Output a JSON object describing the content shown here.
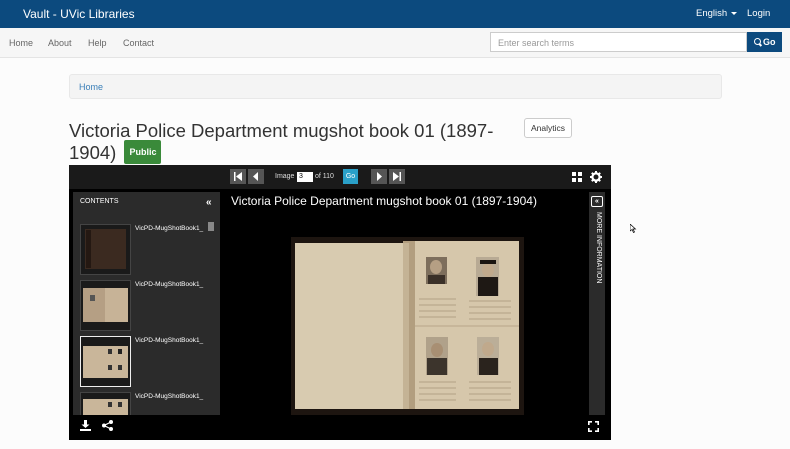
{
  "navbar": {
    "brand": "Vault - UVic Libraries",
    "language": "English",
    "login": "Login",
    "brand_color": "#0c4a7e"
  },
  "subnav": {
    "links": [
      "Home",
      "About",
      "Help",
      "Contact"
    ],
    "search_placeholder": "Enter search terms",
    "search_button": "Go"
  },
  "breadcrumb": {
    "home": "Home"
  },
  "record": {
    "title": "Victoria Police Department mugshot book 01 (1897-1904)",
    "status_badge": "Public",
    "analytics_button": "Analytics"
  },
  "viewer": {
    "image_label": "Image",
    "current_page": "3",
    "of_label": "of 110",
    "go_button": "Go",
    "contents_header": "CONTENTS",
    "thumbnails": [
      {
        "label": "VicPD-MugShotBook1_"
      },
      {
        "label": "VicPD-MugShotBook1_"
      },
      {
        "label": "VicPD-MugShotBook1_"
      },
      {
        "label": "VicPD-MugShotBook1_"
      }
    ],
    "image_title": "Victoria Police Department mugshot book 01 (1897-1904)",
    "more_information": "MORE INFORMATION"
  }
}
